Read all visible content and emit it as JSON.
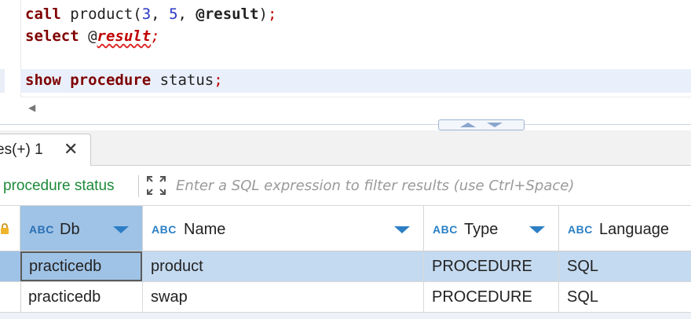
{
  "editor": {
    "line1": {
      "kw": "call",
      "fn": " product(",
      "n1": "3",
      "c1": ", ",
      "n2": "5",
      "c2": ", ",
      "var": "@result",
      "close": ")",
      "semi": ";"
    },
    "line2": {
      "kw": "select",
      "sp": " ",
      "at": "@",
      "var": "result",
      "semi": ";"
    },
    "line4": {
      "kw1": "show",
      "sp1": " ",
      "kw2": "procedure",
      "rest": " status",
      "semi": ";"
    }
  },
  "tab": {
    "label": "es(+) 1",
    "close_icon": "close-icon"
  },
  "filter": {
    "query": "procedure status",
    "placeholder": "Enter a SQL expression to filter results (use Ctrl+Space)"
  },
  "grid": {
    "type_badge": "ABC",
    "columns": [
      "Db",
      "Name",
      "Type",
      "Language"
    ],
    "rows": [
      [
        "practicedb",
        "product",
        "PROCEDURE",
        "SQL"
      ],
      [
        "practicedb",
        "swap",
        "PROCEDURE",
        "SQL"
      ]
    ]
  },
  "colors": {
    "keyword": "#7f0000",
    "number": "#2b36c8",
    "error": "#c00000",
    "query_green": "#1c8a3a",
    "accent_blue": "#2a7fc4",
    "selection": "#c4daf0"
  }
}
